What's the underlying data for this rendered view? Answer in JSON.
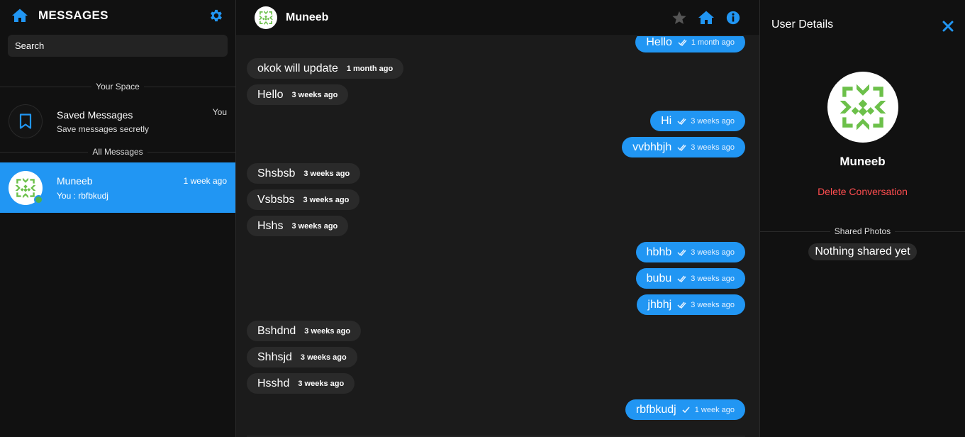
{
  "sidebar": {
    "title": "MESSAGES",
    "search_placeholder": "Search",
    "your_space_label": "Your Space",
    "saved": {
      "title": "Saved Messages",
      "subtitle": "Save messages secretly",
      "badge": "You"
    },
    "all_messages_label": "All Messages",
    "contacts": [
      {
        "name": "Muneeb",
        "last_message": "You : rbfbkudj",
        "time": "1 week ago"
      }
    ]
  },
  "chat": {
    "name": "Muneeb",
    "messages": [
      {
        "dir": "out",
        "text": "Hello",
        "time": "1 month ago"
      },
      {
        "dir": "in",
        "text": "okok will update",
        "time": "1 month ago"
      },
      {
        "dir": "in",
        "text": "Hello",
        "time": "3 weeks ago"
      },
      {
        "dir": "out",
        "text": "Hi",
        "time": "3 weeks ago"
      },
      {
        "dir": "out",
        "text": "vvbhbjh",
        "time": "3 weeks ago"
      },
      {
        "dir": "in",
        "text": "Shsbsb",
        "time": "3 weeks ago"
      },
      {
        "dir": "in",
        "text": "Vsbsbs",
        "time": "3 weeks ago"
      },
      {
        "dir": "in",
        "text": "Hshs",
        "time": "3 weeks ago"
      },
      {
        "dir": "out",
        "text": "hbhb",
        "time": "3 weeks ago"
      },
      {
        "dir": "out",
        "text": "bubu",
        "time": "3 weeks ago"
      },
      {
        "dir": "out",
        "text": "jhbhj",
        "time": "3 weeks ago"
      },
      {
        "dir": "in",
        "text": "Bshdnd",
        "time": "3 weeks ago"
      },
      {
        "dir": "in",
        "text": "Shhsjd",
        "time": "3 weeks ago"
      },
      {
        "dir": "in",
        "text": "Hsshd",
        "time": "3 weeks ago"
      },
      {
        "dir": "out",
        "text": "rbfbkudj",
        "time": "1 week ago"
      }
    ]
  },
  "details": {
    "title": "User Details",
    "name": "Muneeb",
    "delete_label": "Delete Conversation",
    "shared_photos_label": "Shared Photos",
    "empty_label": "Nothing shared yet"
  },
  "colors": {
    "accent": "#2196f3",
    "danger": "#ff4d4f",
    "online": "#4caf50",
    "avatar_green": "#6cc04a"
  }
}
